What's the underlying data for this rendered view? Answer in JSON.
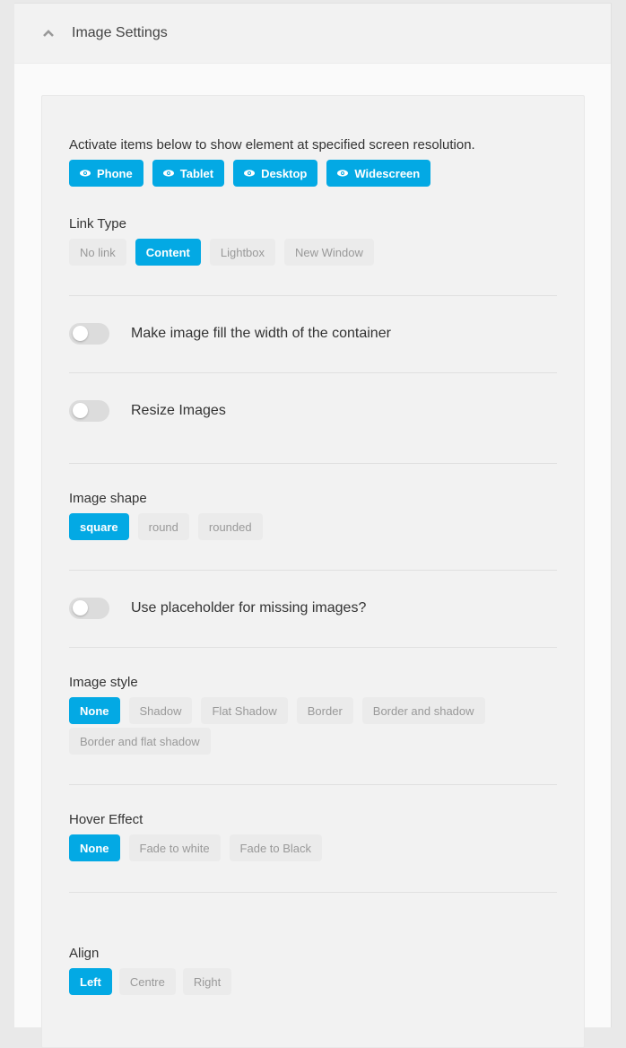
{
  "header": {
    "title": "Image Settings",
    "icon": "chevron-up-icon"
  },
  "visibility": {
    "description": "Activate items below to show element at specified screen resolution.",
    "buttons": [
      {
        "label": "Phone",
        "icon": "eye-icon",
        "active": true
      },
      {
        "label": "Tablet",
        "icon": "eye-icon",
        "active": true
      },
      {
        "label": "Desktop",
        "icon": "eye-icon",
        "active": true
      },
      {
        "label": "Widescreen",
        "icon": "eye-icon",
        "active": true
      }
    ]
  },
  "link_type": {
    "label": "Link Type",
    "options": [
      "No link",
      "Content",
      "Lightbox",
      "New Window"
    ],
    "selected": "Content"
  },
  "fill_width": {
    "label": "Make image fill the width of the container",
    "on": false
  },
  "resize_images": {
    "label": "Resize Images",
    "on": false
  },
  "image_shape": {
    "label": "Image shape",
    "options": [
      "square",
      "round",
      "rounded"
    ],
    "selected": "square"
  },
  "placeholder": {
    "label": "Use placeholder for missing images?",
    "on": false
  },
  "image_style": {
    "label": "Image style",
    "options": [
      "None",
      "Shadow",
      "Flat Shadow",
      "Border",
      "Border and shadow",
      "Border and flat shadow"
    ],
    "selected": "None"
  },
  "hover_effect": {
    "label": "Hover Effect",
    "options": [
      "None",
      "Fade to white",
      "Fade to Black"
    ],
    "selected": "None"
  },
  "align": {
    "label": "Align",
    "options": [
      "Left",
      "Centre",
      "Right"
    ],
    "selected": "Left"
  },
  "colors": {
    "accent": "#03a9e4",
    "inactive_bg": "#ebebeb",
    "inactive_text": "#999999"
  }
}
